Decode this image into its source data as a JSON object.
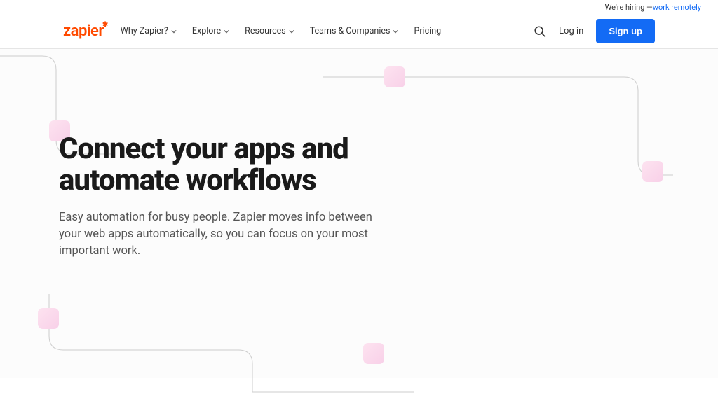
{
  "topbar": {
    "prefix": "We're hiring — ",
    "link": "work remotely"
  },
  "logo": "zapier",
  "nav": [
    {
      "label": "Why Zapier?",
      "dd": true
    },
    {
      "label": "Explore",
      "dd": true
    },
    {
      "label": "Resources",
      "dd": true
    },
    {
      "label": "Teams & Companies",
      "dd": true
    },
    {
      "label": "Pricing",
      "dd": false
    }
  ],
  "login": "Log in",
  "signup": "Sign up",
  "hero": {
    "title": "Connect your apps and automate workflows",
    "subtitle": "Easy automation for busy people. Zapier moves info between your web apps automatically, so you can focus on your most important work."
  }
}
